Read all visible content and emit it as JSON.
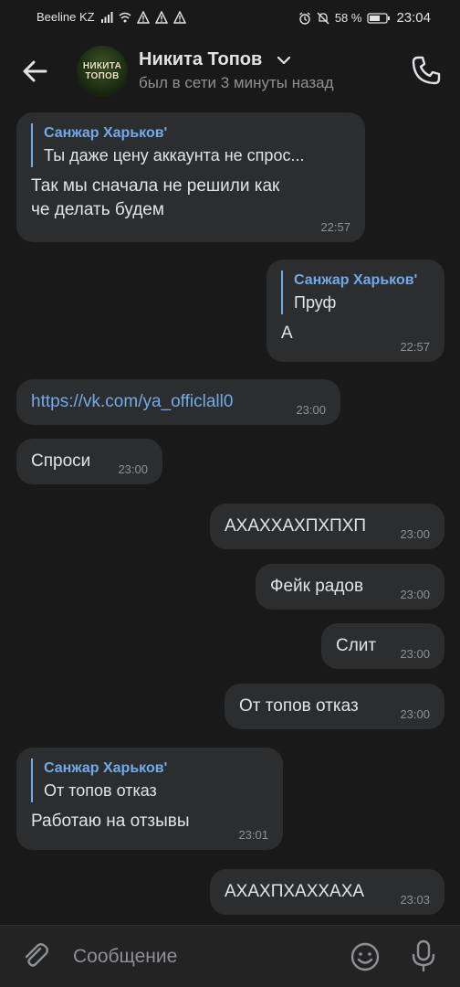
{
  "status_bar": {
    "carrier": "Beeline KZ",
    "battery": "58 %",
    "time": "23:04"
  },
  "header": {
    "name": "Никита Топов",
    "status": "был в сети 3 минуты назад",
    "avatar_line1": "НИКИТА",
    "avatar_line2": "ТОПОВ"
  },
  "messages": [
    {
      "side": "in",
      "quote_author": "Санжар Харьков'",
      "quote_text": "Ты даже цену аккаунта не спрос...",
      "text_line1": "Так мы сначала не решили как",
      "text_line2": "че делать будем",
      "time": "22:57"
    },
    {
      "side": "out",
      "quote_author": "Санжар Харьков'",
      "quote_text": "Пруф",
      "text": "А",
      "time": "22:57"
    },
    {
      "side": "in",
      "text": "https://vk.com/ya_officlall0",
      "time": "23:00"
    },
    {
      "side": "in",
      "text": "Спроси",
      "time": "23:00"
    },
    {
      "side": "out",
      "text": "АХАХХАХПХПХП",
      "time": "23:00"
    },
    {
      "side": "out",
      "text": "Фейк радов",
      "time": "23:00"
    },
    {
      "side": "out",
      "text": "Слит",
      "time": "23:00"
    },
    {
      "side": "out",
      "text": "От топов отказ",
      "time": "23:00"
    },
    {
      "side": "in",
      "quote_author": "Санжар Харьков'",
      "quote_text": "От топов отказ",
      "text": "Работаю на отзывы",
      "time": "23:01"
    },
    {
      "side": "out",
      "text": "АХАХПХАХХАХА",
      "time": "23:03"
    }
  ],
  "composer": {
    "placeholder": "Сообщение"
  },
  "colors": {
    "background": "#19191a",
    "bubble": "#2c2d2e",
    "accent": "#71aaeb",
    "secondary_text": "#8d9196"
  },
  "icons": [
    "back-arrow-icon",
    "chevron-down-icon",
    "phone-icon",
    "paperclip-icon",
    "emoji-icon",
    "microphone-icon"
  ]
}
